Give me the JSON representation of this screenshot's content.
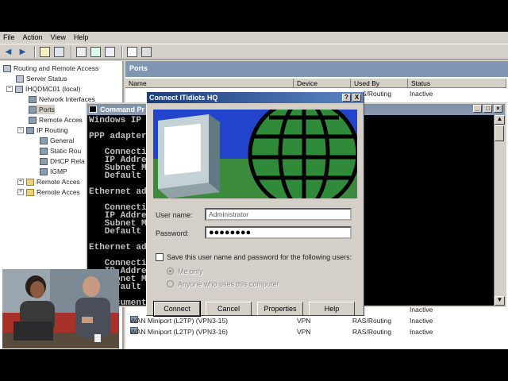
{
  "menu": {
    "file": "File",
    "action": "Action",
    "view": "View",
    "help": "Help"
  },
  "tree": {
    "items": [
      "Routing and Remote Access",
      "Server Status",
      "IHQDMC01 (local)",
      "Network Interfaces",
      "Ports",
      "Remote Acces",
      "IP Routing",
      "General",
      "Static Rou",
      "DHCP Rela",
      "IGMP",
      "Remote Acces",
      "Remote Acces"
    ]
  },
  "list": {
    "title": "Ports",
    "columns": [
      "Name",
      "Device",
      "Used By",
      "Status"
    ],
    "top_row": {
      "used_by": "RAS/Routing",
      "status": "Inactive"
    },
    "bottom_rows": [
      {
        "name": "",
        "device": "",
        "used_by": "",
        "status": "Inactive"
      },
      {
        "name": "WAN Miniport (L2TP) (VPN3-15)",
        "device": "VPN",
        "used_by": "RAS/Routing",
        "status": "Inactive"
      },
      {
        "name": "WAN Miniport (L2TP) (VPN3-16)",
        "device": "VPN",
        "used_by": "RAS/Routing",
        "status": "Inactive"
      }
    ]
  },
  "cmd": {
    "title": "Command Pr",
    "lines": [
      "Windows IP",
      "",
      "PPP adapter",
      "",
      "   Connecti",
      "   IP Addre",
      "   Subnet M",
      "   Default",
      "",
      "Ethernet ad",
      "",
      "   Connecti",
      "   IP Addre",
      "   Subnet M",
      "   Default",
      "",
      "Ethernet ad",
      "",
      "   Connecti",
      "   IP Addre",
      "   Subnet M",
      "   Default",
      "",
      "C:\\Documents"
    ]
  },
  "dialog": {
    "title": "Connect ITidiots HQ",
    "username_label": "User name:",
    "username_value": "Administrator",
    "password_label": "Password:",
    "password_value": "●●●●●●●●",
    "save_label": "Save this user name and password for the following users:",
    "me_only": "Me only",
    "anyone": "Anyone who uses this computer",
    "connect": "Connect",
    "cancel": "Cancel",
    "properties": "Properties",
    "help": "Help",
    "help_btn": "?",
    "close_btn": "X"
  },
  "colors": {
    "title_dark": "#1c3e7a",
    "title_light": "#5c85c4",
    "panel_title": "#7f97b5",
    "banner_sky": "#2244cc",
    "banner_grass": "#3c8a3c"
  }
}
